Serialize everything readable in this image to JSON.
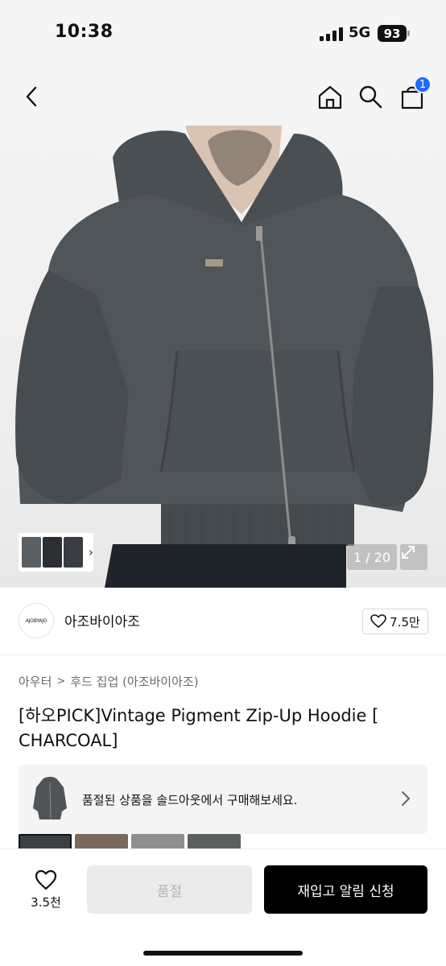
{
  "status_bar": {
    "time": "10:38",
    "network": "5G",
    "battery": "93"
  },
  "header": {
    "back_icon": "chevron-left-icon",
    "home_icon": "home-icon",
    "search_icon": "search-icon",
    "cart_icon": "shopping-bag-icon",
    "cart_count": "1"
  },
  "gallery": {
    "counter": "1 / 20",
    "current_index": 1,
    "total": 20,
    "thumb_arrow": "›"
  },
  "brand": {
    "logo_text": "AJOBYAJO",
    "name": "아조바이아조",
    "like_count": "7.5만"
  },
  "breadcrumb": {
    "category": "아우터",
    "separator": ">",
    "subcategory": "후드 집업 (아조바이아조)"
  },
  "product": {
    "title": "[하오PICK]Vintage Pigment Zip-Up Hoodie [ CHARCOAL]"
  },
  "soldout_banner": {
    "text": "품절된 상품을 솔드아웃에서 구매해보세요."
  },
  "bottom_bar": {
    "wish_count": "3.5천",
    "soldout_label": "품절",
    "restock_label": "재입고 알림 신청"
  },
  "colors": {
    "accent": "#1f6bff",
    "primary_button": "#000000",
    "disabled_button": "#ebebeb",
    "hoodie": "#4f5459"
  }
}
